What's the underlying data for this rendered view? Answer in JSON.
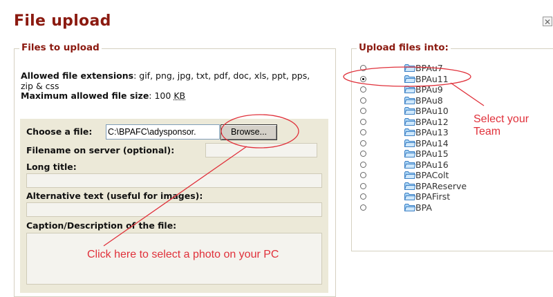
{
  "dialog": {
    "title": "File upload",
    "close_symbol": "✕"
  },
  "left": {
    "legend": "Files to upload",
    "allowed_ext_label": "Allowed file extensions",
    "allowed_ext_value": ": gif, png, jpg, txt, pdf, doc, xls, ppt, pps, zip & css",
    "max_size_label": "Maximum allowed file size",
    "max_size_value": ": 100 ",
    "max_size_unit": "KB",
    "choose_label": "Choose a file:",
    "file_value": "C:\\BPAFC\\adysponsor.",
    "browse_label": "Browse...",
    "filename_label": "Filename on server (optional):",
    "long_title_label": "Long title:",
    "alt_text_label": "Alternative text (useful for images):",
    "caption_label": "Caption/Description of the file:"
  },
  "right": {
    "legend": "Upload files into:",
    "teams": [
      {
        "name": "BPAu7",
        "selected": false
      },
      {
        "name": "BPAu11",
        "selected": true
      },
      {
        "name": "BPAu9",
        "selected": false
      },
      {
        "name": "BPAu8",
        "selected": false
      },
      {
        "name": "BPAu10",
        "selected": false
      },
      {
        "name": "BPAu12",
        "selected": false
      },
      {
        "name": "BPAu13",
        "selected": false
      },
      {
        "name": "BPAu14",
        "selected": false
      },
      {
        "name": "BPAu15",
        "selected": false
      },
      {
        "name": "BPAu16",
        "selected": false
      },
      {
        "name": "BPAColt",
        "selected": false
      },
      {
        "name": "BPAReserve",
        "selected": false
      },
      {
        "name": "BPAFirst",
        "selected": false
      },
      {
        "name": "BPA",
        "selected": false
      }
    ]
  },
  "annotations": {
    "team_note_line1": "Select your",
    "team_note_line2": "Team",
    "browse_note": "Click here to select a photo on your PC",
    "color": "#e0303a"
  }
}
